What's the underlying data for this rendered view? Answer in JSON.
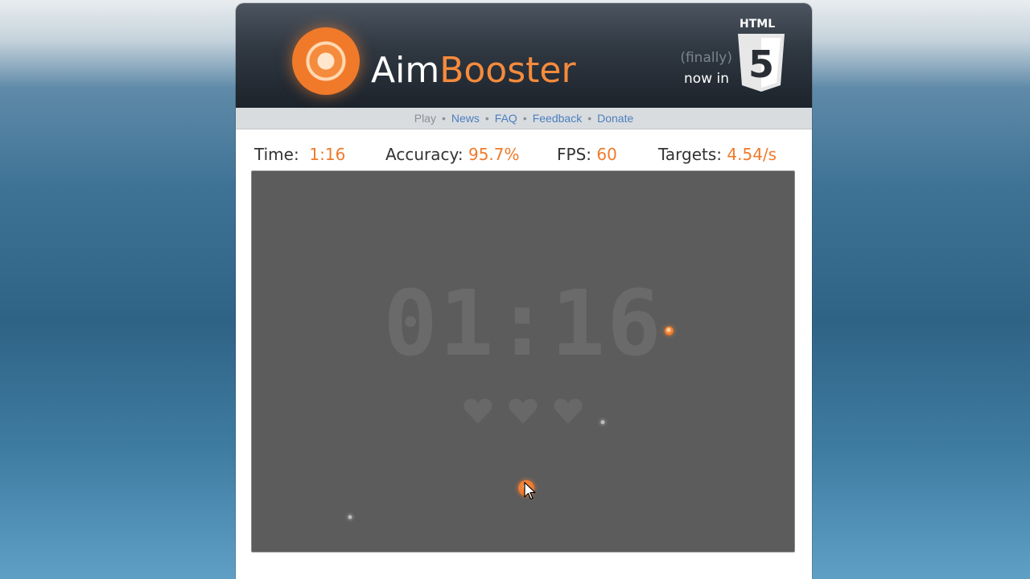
{
  "header": {
    "logo_aim": "Aim",
    "logo_booster": "Booster",
    "tag_finally": "(finally)",
    "tag_now_in": "now in",
    "html5_label": "HTML",
    "html5_number": "5"
  },
  "nav": {
    "items": [
      {
        "label": "Play",
        "active": true
      },
      {
        "label": "News"
      },
      {
        "label": "FAQ"
      },
      {
        "label": "Feedback"
      },
      {
        "label": "Donate"
      }
    ],
    "separator": "•"
  },
  "stats": {
    "time_label": "Time",
    "time_value": "1:16",
    "accuracy_label": "Accuracy",
    "accuracy_value": "95.7%",
    "fps_label": "FPS",
    "fps_value": "60",
    "targets_label": "Targets",
    "targets_value": "4.54/s",
    "colon": ":"
  },
  "game": {
    "clock": "01:16",
    "lives": 3,
    "targets": [
      {
        "kind": "orange",
        "state": "active"
      },
      {
        "kind": "orange",
        "state": "active"
      },
      {
        "kind": "grey",
        "state": "fading"
      },
      {
        "kind": "grey",
        "state": "fading"
      }
    ]
  },
  "colors": {
    "accent": "#f07a2a",
    "link": "#4b7fbf",
    "header_dark": "#1c232b",
    "game_bg": "#5c5c5c"
  },
  "icons": [
    "aimbooster-logo-icon",
    "html5-shield-icon",
    "heart-icon",
    "cursor-arrow-icon"
  ]
}
